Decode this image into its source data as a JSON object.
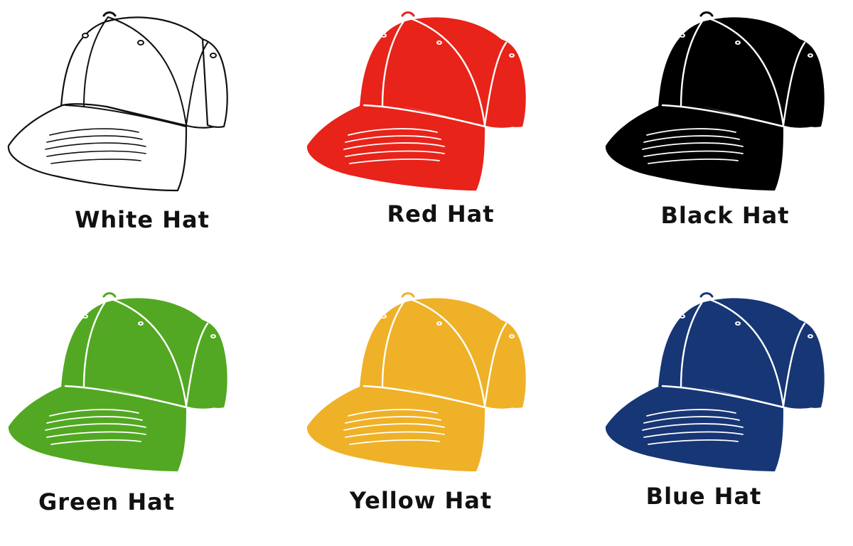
{
  "hats": [
    {
      "label": "White Hat",
      "fill": "#ffffff",
      "stroke": "#111111",
      "seam": "#111111"
    },
    {
      "label": "Red Hat",
      "fill": "#e8231a",
      "stroke": "#e8231a",
      "seam": "#ffffff"
    },
    {
      "label": "Black Hat",
      "fill": "#000000",
      "stroke": "#000000",
      "seam": "#ffffff"
    },
    {
      "label": "Green Hat",
      "fill": "#52a822",
      "stroke": "#52a822",
      "seam": "#ffffff"
    },
    {
      "label": "Yellow Hat",
      "fill": "#efb128",
      "stroke": "#efb128",
      "seam": "#ffffff"
    },
    {
      "label": "Blue Hat",
      "fill": "#173675",
      "stroke": "#173675",
      "seam": "#ffffff"
    }
  ]
}
